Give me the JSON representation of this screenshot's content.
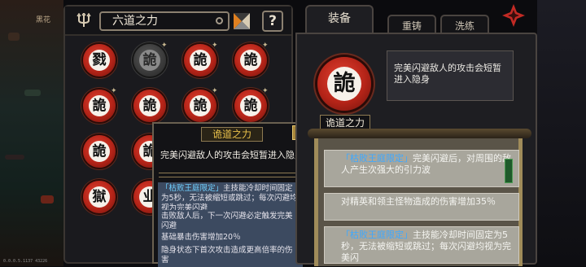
{
  "header": {
    "panel_title": "六道之力",
    "help_label": "?",
    "corner_text": "黑花"
  },
  "runes": [
    {
      "char": "戮",
      "state": "active"
    },
    {
      "char": "詭",
      "state": "dim"
    },
    {
      "char": "詭",
      "state": "active"
    },
    {
      "char": "詭",
      "state": "active"
    },
    {
      "char": "詭",
      "state": "active"
    },
    {
      "char": "詭",
      "state": "active"
    },
    {
      "char": "詭",
      "state": "active"
    },
    {
      "char": "詭",
      "state": "active"
    },
    {
      "char": "詭",
      "state": "active"
    },
    {
      "char": "詭",
      "state": "active"
    },
    {
      "char": "獄",
      "state": "active"
    },
    {
      "char": "业",
      "state": "active"
    }
  ],
  "tooltip": {
    "title": "诡道之力",
    "description": "完美闪避敌人的攻击会短暂进入隐身",
    "rows": [
      {
        "highlight": "「枯败王庭限定」",
        "text": "主技能冷却时间固定为5秒，无法被缩短或跳过；每次闪避均视为完美闪避"
      },
      {
        "highlight": "",
        "text": "击败敌人后，下一次闪避必定触发完美闪避"
      },
      {
        "highlight": "",
        "text": "基础暴击伤害增加20％"
      },
      {
        "highlight": "",
        "text": "隐身状态下首次攻击造成更高倍率的伤害"
      }
    ]
  },
  "tabs": {
    "equip": "装备",
    "recast": "重铸",
    "wash": "洗练"
  },
  "equipped": {
    "char": "詭",
    "label": "诡道之力",
    "description": "完美闪避敌人的攻击会短暂进入隐身"
  },
  "effects": [
    {
      "highlight": "「枯败王庭限定」",
      "text": "完美闪避后，对周围的敌人产生次强大的引力波"
    },
    {
      "highlight": "",
      "text": "对精英和领主怪物造成的伤害增加35％"
    },
    {
      "highlight": "「枯败王庭限定」",
      "text": "主技能冷却时间固定为5秒，无法被缩短或跳过；每次闪避均视为完美闪"
    }
  ],
  "version": "0.0.0.5.1137 43226"
}
